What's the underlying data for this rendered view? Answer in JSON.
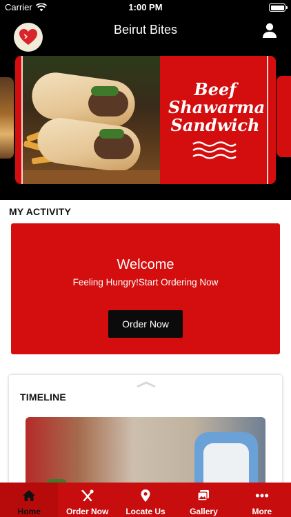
{
  "status_bar": {
    "carrier": "Carrier",
    "time": "1:00 PM"
  },
  "header": {
    "title": "Beirut Bites",
    "logo_icon": "heart-logo-icon",
    "profile_icon": "user-icon"
  },
  "banner": {
    "title_line1": "Beef",
    "title_line2": "Shawarma",
    "title_line3": "Sandwich"
  },
  "activity": {
    "section_title": "MY ACTIVITY",
    "welcome_title": "Welcome",
    "welcome_subtitle": "Feeling Hungry!Start Ordering Now",
    "order_button": "Order Now"
  },
  "timeline": {
    "section_title": "TIMELINE"
  },
  "tabbar": {
    "items": [
      {
        "label": "Home",
        "icon": "home-icon",
        "active": true
      },
      {
        "label": "Order Now",
        "icon": "utensils-icon",
        "active": false
      },
      {
        "label": "Locate Us",
        "icon": "map-pin-icon",
        "active": false
      },
      {
        "label": "Gallery",
        "icon": "gallery-icon",
        "active": false
      },
      {
        "label": "More",
        "icon": "more-dots-icon",
        "active": false
      }
    ]
  },
  "colors": {
    "brand_red": "#d40e0e",
    "tabbar_red": "#c70d0d",
    "header_black": "#000000"
  }
}
